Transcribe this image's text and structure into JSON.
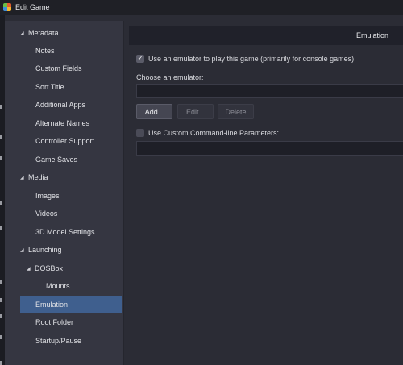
{
  "window": {
    "title": "Edit Game",
    "icon": "launchbox-app-icon"
  },
  "tree": {
    "items": [
      {
        "label": "Metadata",
        "expanded": true,
        "level": 0
      },
      {
        "label": "Notes",
        "level": 1
      },
      {
        "label": "Custom Fields",
        "level": 1
      },
      {
        "label": "Sort Title",
        "level": 1
      },
      {
        "label": "Additional Apps",
        "level": 1
      },
      {
        "label": "Alternate Names",
        "level": 1
      },
      {
        "label": "Controller Support",
        "level": 1
      },
      {
        "label": "Game Saves",
        "level": 1
      },
      {
        "label": "Media",
        "expanded": true,
        "level": 0
      },
      {
        "label": "Images",
        "level": 1
      },
      {
        "label": "Videos",
        "level": 1
      },
      {
        "label": "3D Model Settings",
        "level": 1
      },
      {
        "label": "Launching",
        "expanded": true,
        "level": 0
      },
      {
        "label": "DOSBox",
        "expanded": true,
        "level": 1
      },
      {
        "label": "Mounts",
        "level": 2
      },
      {
        "label": "Emulation",
        "level": 1,
        "selected": true
      },
      {
        "label": "Root Folder",
        "level": 1
      },
      {
        "label": "Startup/Pause",
        "level": 1
      }
    ],
    "expander_glyph": "◢"
  },
  "main": {
    "header": "Emulation",
    "use_emulator": {
      "checked": true,
      "label": "Use an emulator to play this game (primarily for console games)"
    },
    "choose_emulator_label": "Choose an emulator:",
    "emulator_value": "",
    "buttons": {
      "add": "Add...",
      "edit": "Edit...",
      "delete": "Delete"
    },
    "custom_cmd": {
      "checked": false,
      "label": "Use Custom Command-line Parameters:"
    },
    "custom_cmd_value": ""
  },
  "colors": {
    "selected": "#3f5f8e",
    "panel": "#353641",
    "background": "#2b2c35"
  }
}
